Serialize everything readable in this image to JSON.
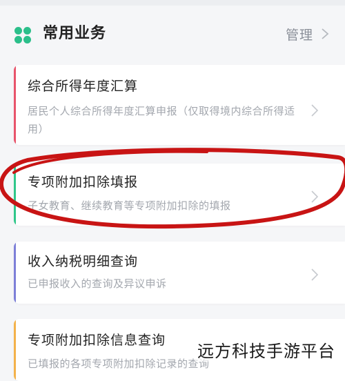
{
  "header": {
    "title": "常用业务",
    "manage_label": "管理",
    "icon": "four-dots-icon",
    "icon_color": "#2bbf8a"
  },
  "cards": [
    {
      "title": "综合所得年度汇算",
      "description": "居民个人综合所得年度汇算申报（仅取得境内综合所得适用）",
      "accent_color": "#e8546b"
    },
    {
      "title": "专项附加扣除填报",
      "description": "子女教育、继续教育等专项附加扣除的填报",
      "accent_color": "#2fc78a"
    },
    {
      "title": "收入纳税明细查询",
      "description": "已申报收入的查询及异议申诉",
      "accent_color": "#7c7fd8"
    },
    {
      "title": "专项附加扣除信息查询",
      "description": "已填报的各项专项附加扣除记录的查询",
      "accent_color": "#f3b24a"
    }
  ],
  "annotation": {
    "ellipse_color": "#c81414"
  },
  "watermark": "远方科技手游平台"
}
